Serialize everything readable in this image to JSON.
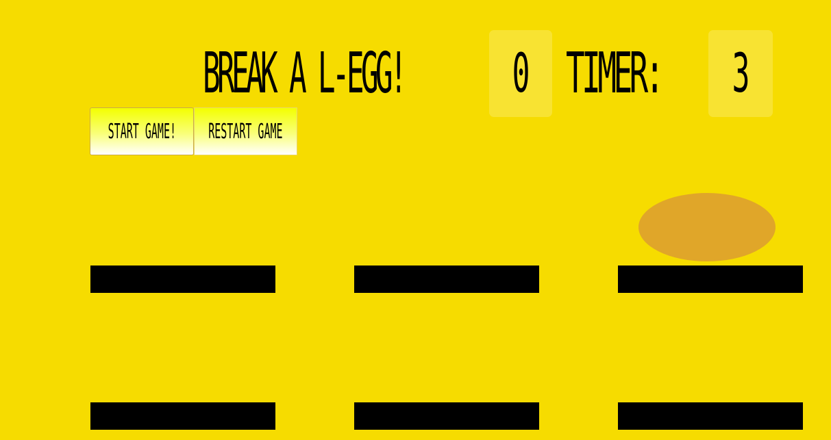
{
  "header": {
    "title": "BREAK A L-EGG!",
    "score": "0",
    "timer_label": "TIMER:",
    "timer": "3"
  },
  "controls": {
    "start_label": "START GAME!",
    "restart_label": "RESTART GAME"
  },
  "board": {
    "hole_color": "#000000",
    "egg_color": "#e0a629",
    "background": "#f6dc00",
    "holes": [
      {
        "has_egg": false
      },
      {
        "has_egg": false
      },
      {
        "has_egg": true
      },
      {
        "has_egg": false
      },
      {
        "has_egg": false
      },
      {
        "has_egg": false
      }
    ]
  }
}
